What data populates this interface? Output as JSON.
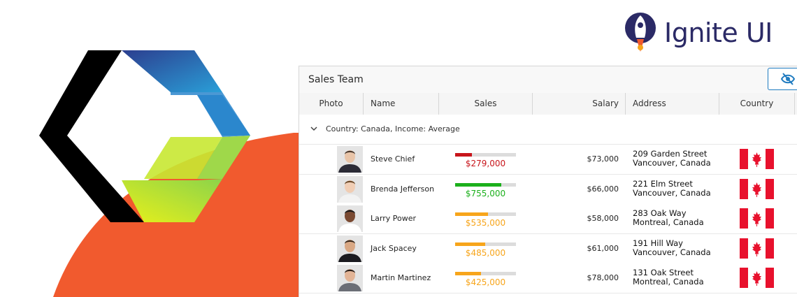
{
  "brand": {
    "product_name": "Ignite UI",
    "colors": {
      "orange": "#f15a2e",
      "navy": "#2b2a66",
      "accent_blue": "#1f7bc0"
    }
  },
  "grid": {
    "title": "Sales Team",
    "toolbar_icon": "eye-slash-icon",
    "columns": [
      {
        "label": "Photo"
      },
      {
        "label": "Name"
      },
      {
        "label": "Sales"
      },
      {
        "label": "Salary"
      },
      {
        "label": "Address"
      },
      {
        "label": "Country"
      }
    ],
    "group": {
      "icon": "chevron-down-icon",
      "label": "Country: Canada, Income: Average"
    },
    "rows": [
      {
        "name": "Steve Chief",
        "sales": "$279,000",
        "sales_level": 0.28,
        "sales_color": "#c8151b",
        "salary": "$73,000",
        "address_line1": "209 Garden Street",
        "address_line2": "Vancouver, Canada",
        "flag": "canada-flag-icon"
      },
      {
        "name": "Brenda Jefferson",
        "sales": "$755,000",
        "sales_level": 0.76,
        "sales_color": "#1cb01c",
        "salary": "$66,000",
        "address_line1": "221 Elm Street",
        "address_line2": "Vancouver, Canada",
        "flag": "canada-flag-icon"
      },
      {
        "name": "Larry Power",
        "sales": "$535,000",
        "sales_level": 0.54,
        "sales_color": "#f7a51b",
        "salary": "$58,000",
        "address_line1": "283 Oak Way",
        "address_line2": "Montreal, Canada",
        "flag": "canada-flag-icon"
      },
      {
        "name": "Jack Spacey",
        "sales": "$485,000",
        "sales_level": 0.49,
        "sales_color": "#f7a51b",
        "salary": "$61,000",
        "address_line1": "191 Hill Way",
        "address_line2": "Vancouver, Canada",
        "flag": "canada-flag-icon"
      },
      {
        "name": "Martin Martinez",
        "sales": "$425,000",
        "sales_level": 0.43,
        "sales_color": "#f7a51b",
        "salary": "$78,000",
        "address_line1": "131 Oak Street",
        "address_line2": "Montreal, Canada",
        "flag": "canada-flag-icon"
      }
    ]
  }
}
